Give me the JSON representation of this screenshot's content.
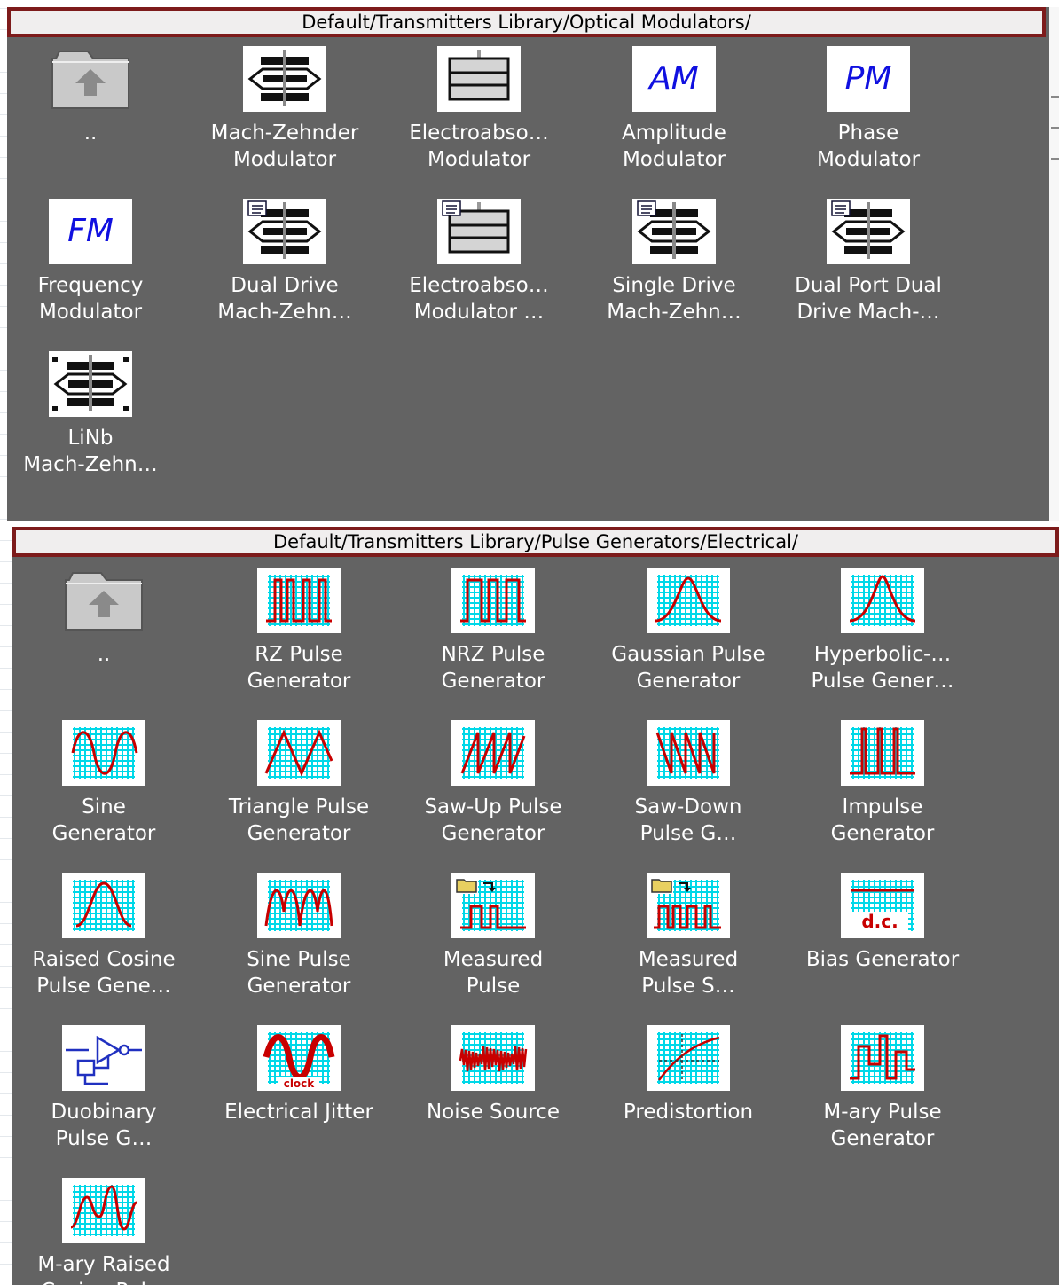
{
  "panels": [
    {
      "path": "Default/Transmitters Library/Optical Modulators/",
      "items": [
        {
          "label": "..",
          "icon": "folder-up-icon"
        },
        {
          "label": "Mach-Zehnder\nModulator",
          "icon": "mach-zehnder-icon"
        },
        {
          "label": "Electroabso…\nModulator",
          "icon": "electroabsorption-icon"
        },
        {
          "label": "Amplitude\nModulator",
          "icon": "am-icon",
          "icon_text": "AM"
        },
        {
          "label": "Phase\nModulator",
          "icon": "pm-icon",
          "icon_text": "PM"
        },
        {
          "label": "Frequency\nModulator",
          "icon": "fm-icon",
          "icon_text": "FM"
        },
        {
          "label": "Dual Drive\nMach-Zehn…",
          "icon": "dual-drive-mach-zehnder-icon"
        },
        {
          "label": "Electroabso…\nModulator …",
          "icon": "electroabsorption-measured-icon"
        },
        {
          "label": "Single Drive\nMach-Zehn…",
          "icon": "single-drive-mach-zehnder-icon"
        },
        {
          "label": "Dual Port Dual\nDrive Mach-…",
          "icon": "dual-port-mach-zehnder-icon"
        },
        {
          "label": "LiNb\nMach-Zehn…",
          "icon": "linb-mach-zehnder-icon"
        }
      ]
    },
    {
      "path": "Default/Transmitters Library/Pulse Generators/Electrical/",
      "items": [
        {
          "label": "..",
          "icon": "folder-up-icon"
        },
        {
          "label": "RZ Pulse\nGenerator",
          "icon": "rz-pulse-icon"
        },
        {
          "label": "NRZ Pulse\nGenerator",
          "icon": "nrz-pulse-icon"
        },
        {
          "label": "Gaussian Pulse\nGenerator",
          "icon": "gaussian-pulse-icon"
        },
        {
          "label": "Hyperbolic-…\nPulse Gener…",
          "icon": "hyperbolic-pulse-icon"
        },
        {
          "label": "Sine\nGenerator",
          "icon": "sine-icon"
        },
        {
          "label": "Triangle Pulse\nGenerator",
          "icon": "triangle-pulse-icon"
        },
        {
          "label": "Saw-Up Pulse\nGenerator",
          "icon": "saw-up-icon"
        },
        {
          "label": "Saw-Down\nPulse G…",
          "icon": "saw-down-icon"
        },
        {
          "label": "Impulse\nGenerator",
          "icon": "impulse-icon"
        },
        {
          "label": "Raised Cosine\nPulse Gene…",
          "icon": "raised-cosine-icon"
        },
        {
          "label": "Sine Pulse\nGenerator",
          "icon": "sine-pulse-icon"
        },
        {
          "label": "Measured\nPulse",
          "icon": "measured-pulse-icon"
        },
        {
          "label": "Measured\nPulse S…",
          "icon": "measured-pulse-sequence-icon"
        },
        {
          "label": "Bias Generator",
          "icon": "bias-dc-icon",
          "icon_text": "d.c."
        },
        {
          "label": "Duobinary\nPulse G…",
          "icon": "duobinary-icon"
        },
        {
          "label": "Electrical Jitter",
          "icon": "jitter-clock-icon",
          "icon_text": "clock"
        },
        {
          "label": "Noise Source",
          "icon": "noise-icon"
        },
        {
          "label": "Predistortion",
          "icon": "predistortion-icon"
        },
        {
          "label": "M-ary Pulse\nGenerator",
          "icon": "mary-pulse-icon"
        },
        {
          "label": "M-ary Raised\nCosine Pul…",
          "icon": "mary-raised-cosine-icon"
        }
      ]
    }
  ]
}
